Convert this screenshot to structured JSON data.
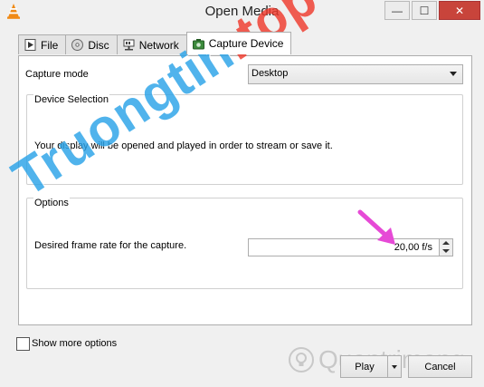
{
  "window": {
    "title": "Open Media",
    "close_glyph": "✕",
    "minimize_glyph": "—",
    "maximize_glyph": "☐"
  },
  "tabs": [
    {
      "label": "File",
      "icon": "file-icon"
    },
    {
      "label": "Disc",
      "icon": "disc-icon"
    },
    {
      "label": "Network",
      "icon": "network-icon"
    },
    {
      "label": "Capture Device",
      "icon": "capture-device-icon",
      "active": true
    }
  ],
  "capture": {
    "mode_label": "Capture mode",
    "mode_value": "Desktop",
    "device_selection_title": "Device Selection",
    "device_selection_text": "Your display will be opened and played in order to stream or save it.",
    "options_title": "Options",
    "frame_rate_label": "Desired frame rate for the capture.",
    "frame_rate_value": "20,00 f/s"
  },
  "footer": {
    "show_more_label": "Show more options",
    "play_label": "Play",
    "cancel_label": "Cancel"
  },
  "watermarks": {
    "main_blue": "Truongtin",
    "main_red": ".top",
    "secondary": "Quantrimang"
  },
  "colors": {
    "annotation_arrow": "#e64ad6",
    "watermark_blue": "#2aa3e8",
    "watermark_red": "#ef3b2d"
  }
}
